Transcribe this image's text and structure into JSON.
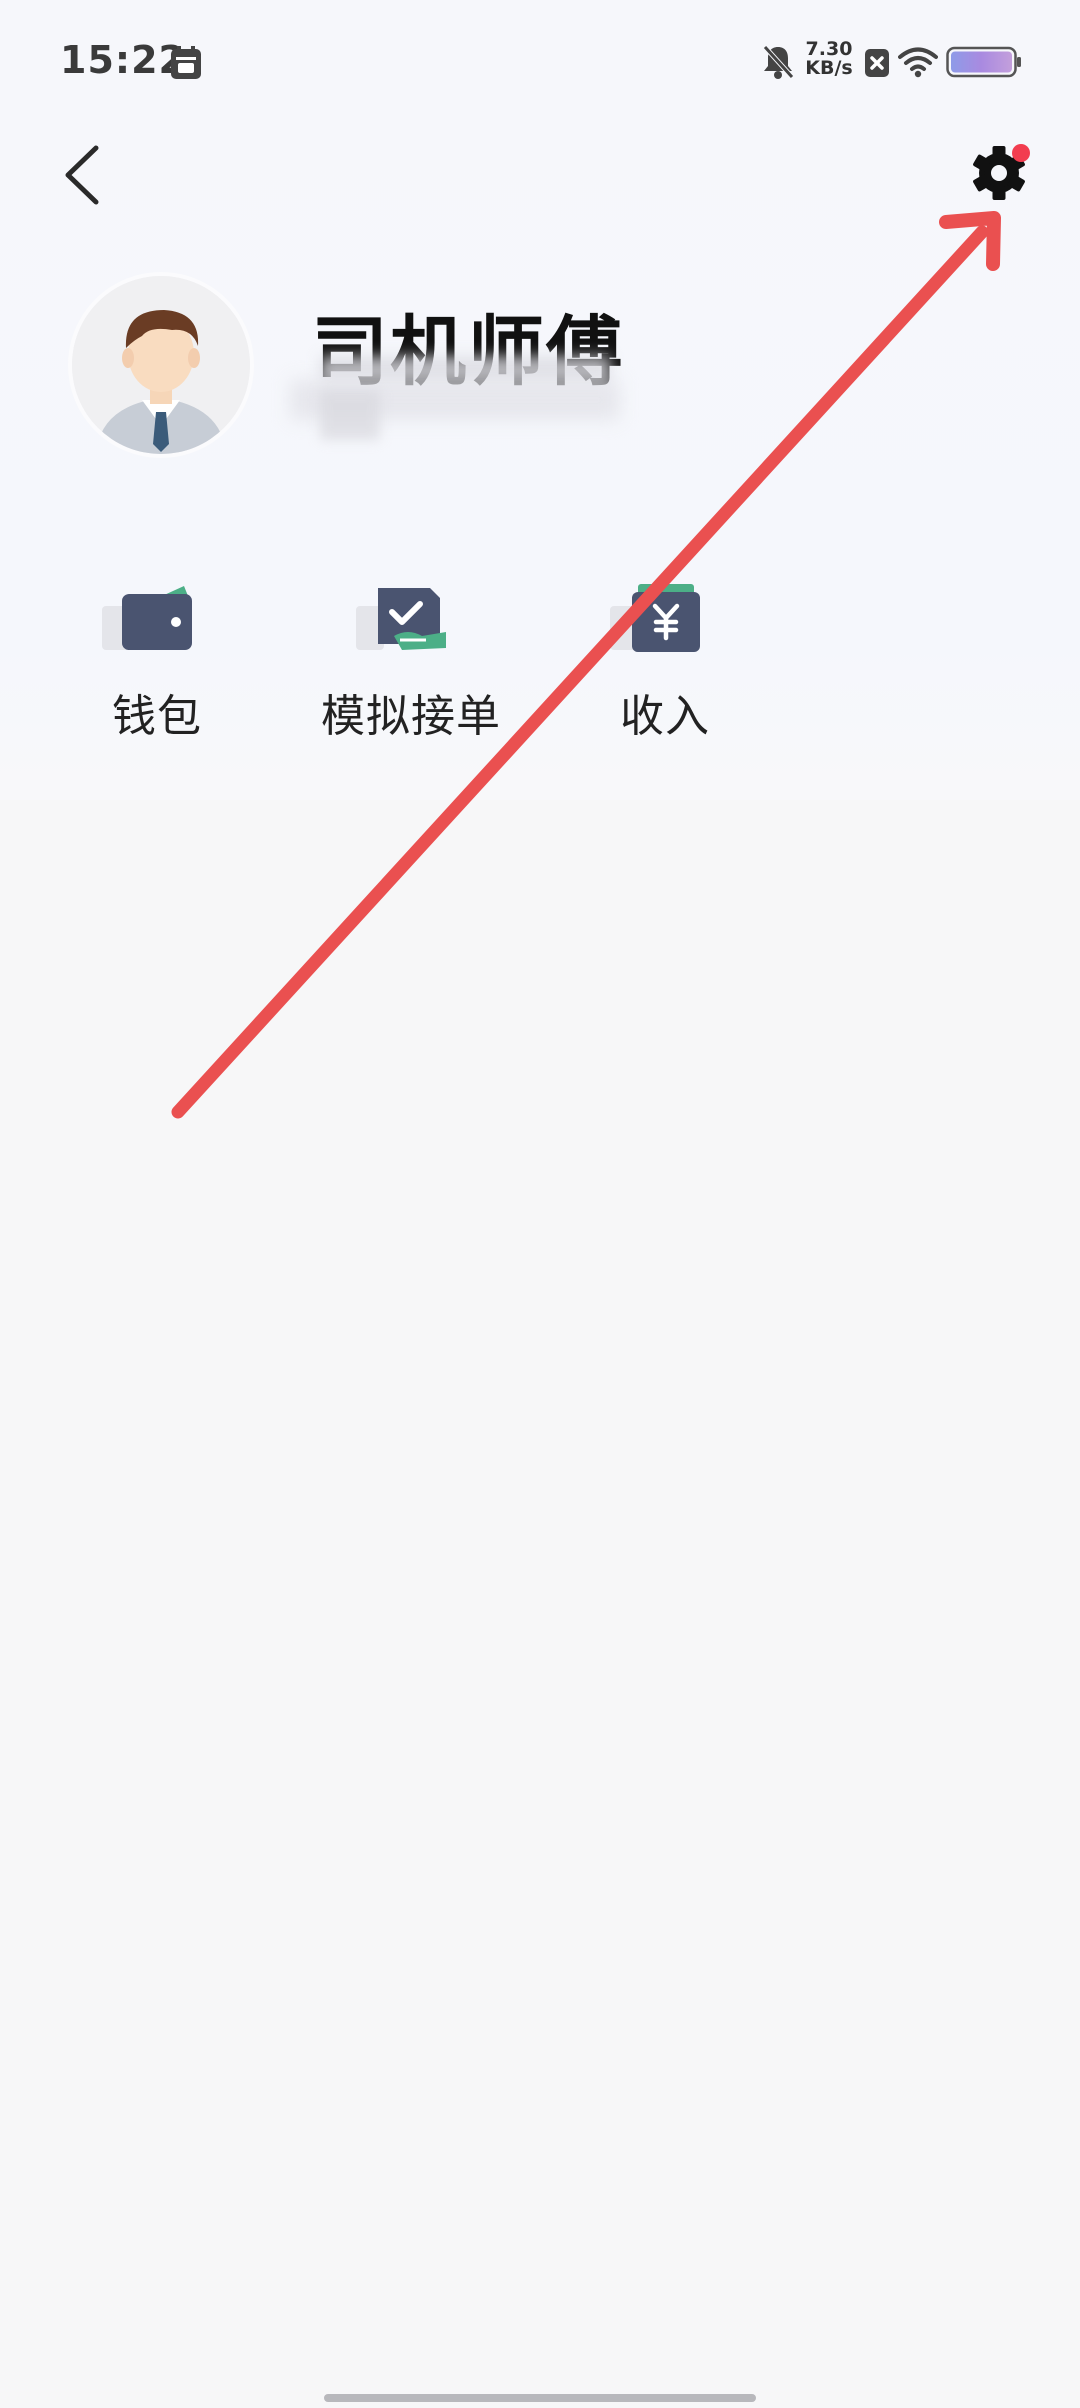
{
  "status_bar": {
    "time": "15:22",
    "net_speed_value": "7.30",
    "net_speed_unit": "KB/s",
    "icons": [
      "calendar-icon",
      "bell-off-icon",
      "close-box-icon",
      "wifi-icon",
      "battery-icon"
    ]
  },
  "header": {
    "back_icon": "chevron-left-icon",
    "settings_icon": "gear-icon",
    "settings_has_badge": true
  },
  "profile": {
    "name": "司机师傅"
  },
  "features": [
    {
      "label": "钱包",
      "icon": "wallet-icon"
    },
    {
      "label": "模拟接单",
      "icon": "order-check-icon"
    },
    {
      "label": "收入",
      "icon": "income-yuan-icon"
    }
  ],
  "colors": {
    "icon_navy": "#4a5470",
    "icon_green": "#4caf87",
    "badge_red": "#f23d4f",
    "annotation_red": "#ea5050"
  }
}
